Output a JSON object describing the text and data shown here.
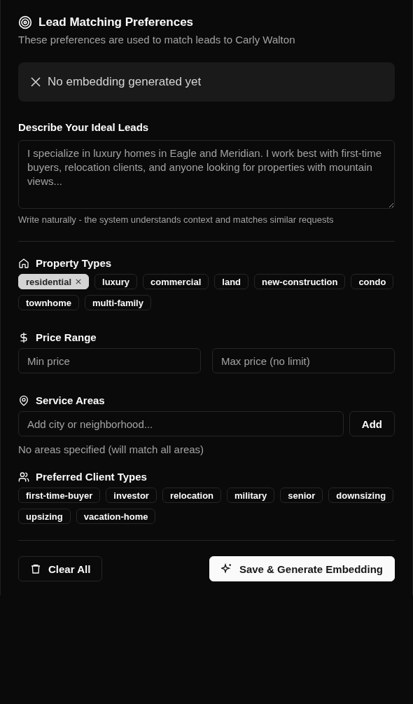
{
  "header": {
    "title": "Lead Matching Preferences",
    "subtitle": "These preferences are used to match leads to Carly Walton"
  },
  "embedding_status": {
    "generated": false,
    "text": "No embedding generated yet"
  },
  "description": {
    "label": "Describe Your Ideal Leads",
    "placeholder": "I specialize in luxury homes in Eagle and Meridian. I work best with first-time buyers, relocation clients, and anyone looking for properties with mountain views...",
    "hint": "Write naturally - the system understands context and matches similar requests"
  },
  "property_types": {
    "label": "Property Types",
    "options": [
      {
        "label": "residential",
        "selected": true
      },
      {
        "label": "luxury",
        "selected": false
      },
      {
        "label": "commercial",
        "selected": false
      },
      {
        "label": "land",
        "selected": false
      },
      {
        "label": "new-construction",
        "selected": false
      },
      {
        "label": "condo",
        "selected": false
      },
      {
        "label": "townhome",
        "selected": false
      },
      {
        "label": "multi-family",
        "selected": false
      }
    ]
  },
  "price_range": {
    "label": "Price Range",
    "min_placeholder": "Min price",
    "max_placeholder": "Max price (no limit)"
  },
  "service_areas": {
    "label": "Service Areas",
    "placeholder": "Add city or neighborhood...",
    "add_button": "Add",
    "empty_note": "No areas specified (will match all areas)"
  },
  "client_types": {
    "label": "Preferred Client Types",
    "options": [
      {
        "label": "first-time-buyer",
        "selected": false
      },
      {
        "label": "investor",
        "selected": false
      },
      {
        "label": "relocation",
        "selected": false
      },
      {
        "label": "military",
        "selected": false
      },
      {
        "label": "senior",
        "selected": false
      },
      {
        "label": "downsizing",
        "selected": false
      },
      {
        "label": "upsizing",
        "selected": false
      },
      {
        "label": "vacation-home",
        "selected": false
      }
    ]
  },
  "actions": {
    "clear": "Clear All",
    "save": "Save & Generate Embedding"
  }
}
